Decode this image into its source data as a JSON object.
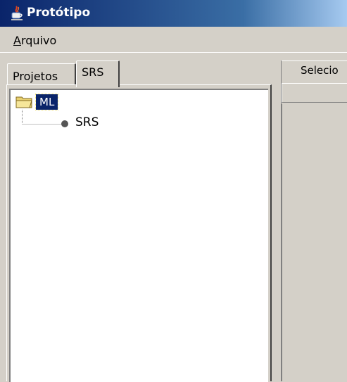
{
  "window": {
    "title": "Protótipo"
  },
  "menu": {
    "items": [
      {
        "mnemonic": "A",
        "rest": "rquivo"
      }
    ]
  },
  "left_tabs": [
    {
      "label": "Projetos"
    },
    {
      "label": "SRS"
    }
  ],
  "tree": {
    "root": "ML",
    "children": [
      {
        "label": "SRS"
      }
    ]
  },
  "right_panel": {
    "tab_label": "Selecio"
  }
}
